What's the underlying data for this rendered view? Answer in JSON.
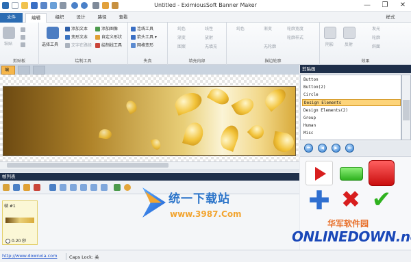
{
  "window": {
    "title": "Untitled - EximiousSoft Banner Maker",
    "minimize": "—",
    "restore": "❐",
    "close": "✕"
  },
  "ribbon_tabs": [
    "文件",
    "编辑",
    "组织",
    "设计",
    "路径",
    "查看"
  ],
  "style_label": "样式",
  "groups": {
    "clipboard": {
      "label": "剪贴板",
      "paste": "粘贴"
    },
    "draw": {
      "label": "绘制工具",
      "select": "选择工具",
      "add_text": "添加文本",
      "transform_text": "变形文本",
      "text_on_path": "文字在路径",
      "add_image": "添加图像",
      "custom_shape": "自定义形状",
      "draw_line": "绘制线工具"
    },
    "fill": {
      "label": "失真",
      "connect": "连线工具",
      "arrow": "箭头工具",
      "mesh": "网格变形"
    },
    "interior": {
      "label": "填充内部",
      "items": [
        "纯色",
        "线性",
        "渐变",
        "放射",
        "图案",
        "无填充"
      ]
    },
    "outline": {
      "label": "描边轮廓",
      "items": [
        "纯色",
        "渐变",
        "轮廓宽度",
        "轮廓样式",
        "无轮廓"
      ]
    },
    "effects": {
      "label": "效果",
      "items": [
        "阴影",
        "反射",
        "发光",
        "轮廓",
        "斜面"
      ]
    }
  },
  "doc_tab": "编辑",
  "frame_panel": {
    "title": "帧列表",
    "frame_label": "帧 #1",
    "frame_time": "0.20 秒"
  },
  "clipboard_panel": {
    "title": "剪贴画",
    "items": [
      "Button",
      "Button(2)",
      "Circle",
      "Design Elements",
      "Design Elements(2)",
      "Group",
      "Human",
      "Misc"
    ],
    "selected": "Design Elements"
  },
  "status": {
    "link": "http://www.downxia.com",
    "caps": "Caps Lock: 关"
  },
  "watermark1": {
    "title": "统一下载站",
    "url": "www.3987.Com"
  },
  "watermark2": {
    "title": "华军软件园",
    "brand": "ONLINEDOWN.net"
  }
}
